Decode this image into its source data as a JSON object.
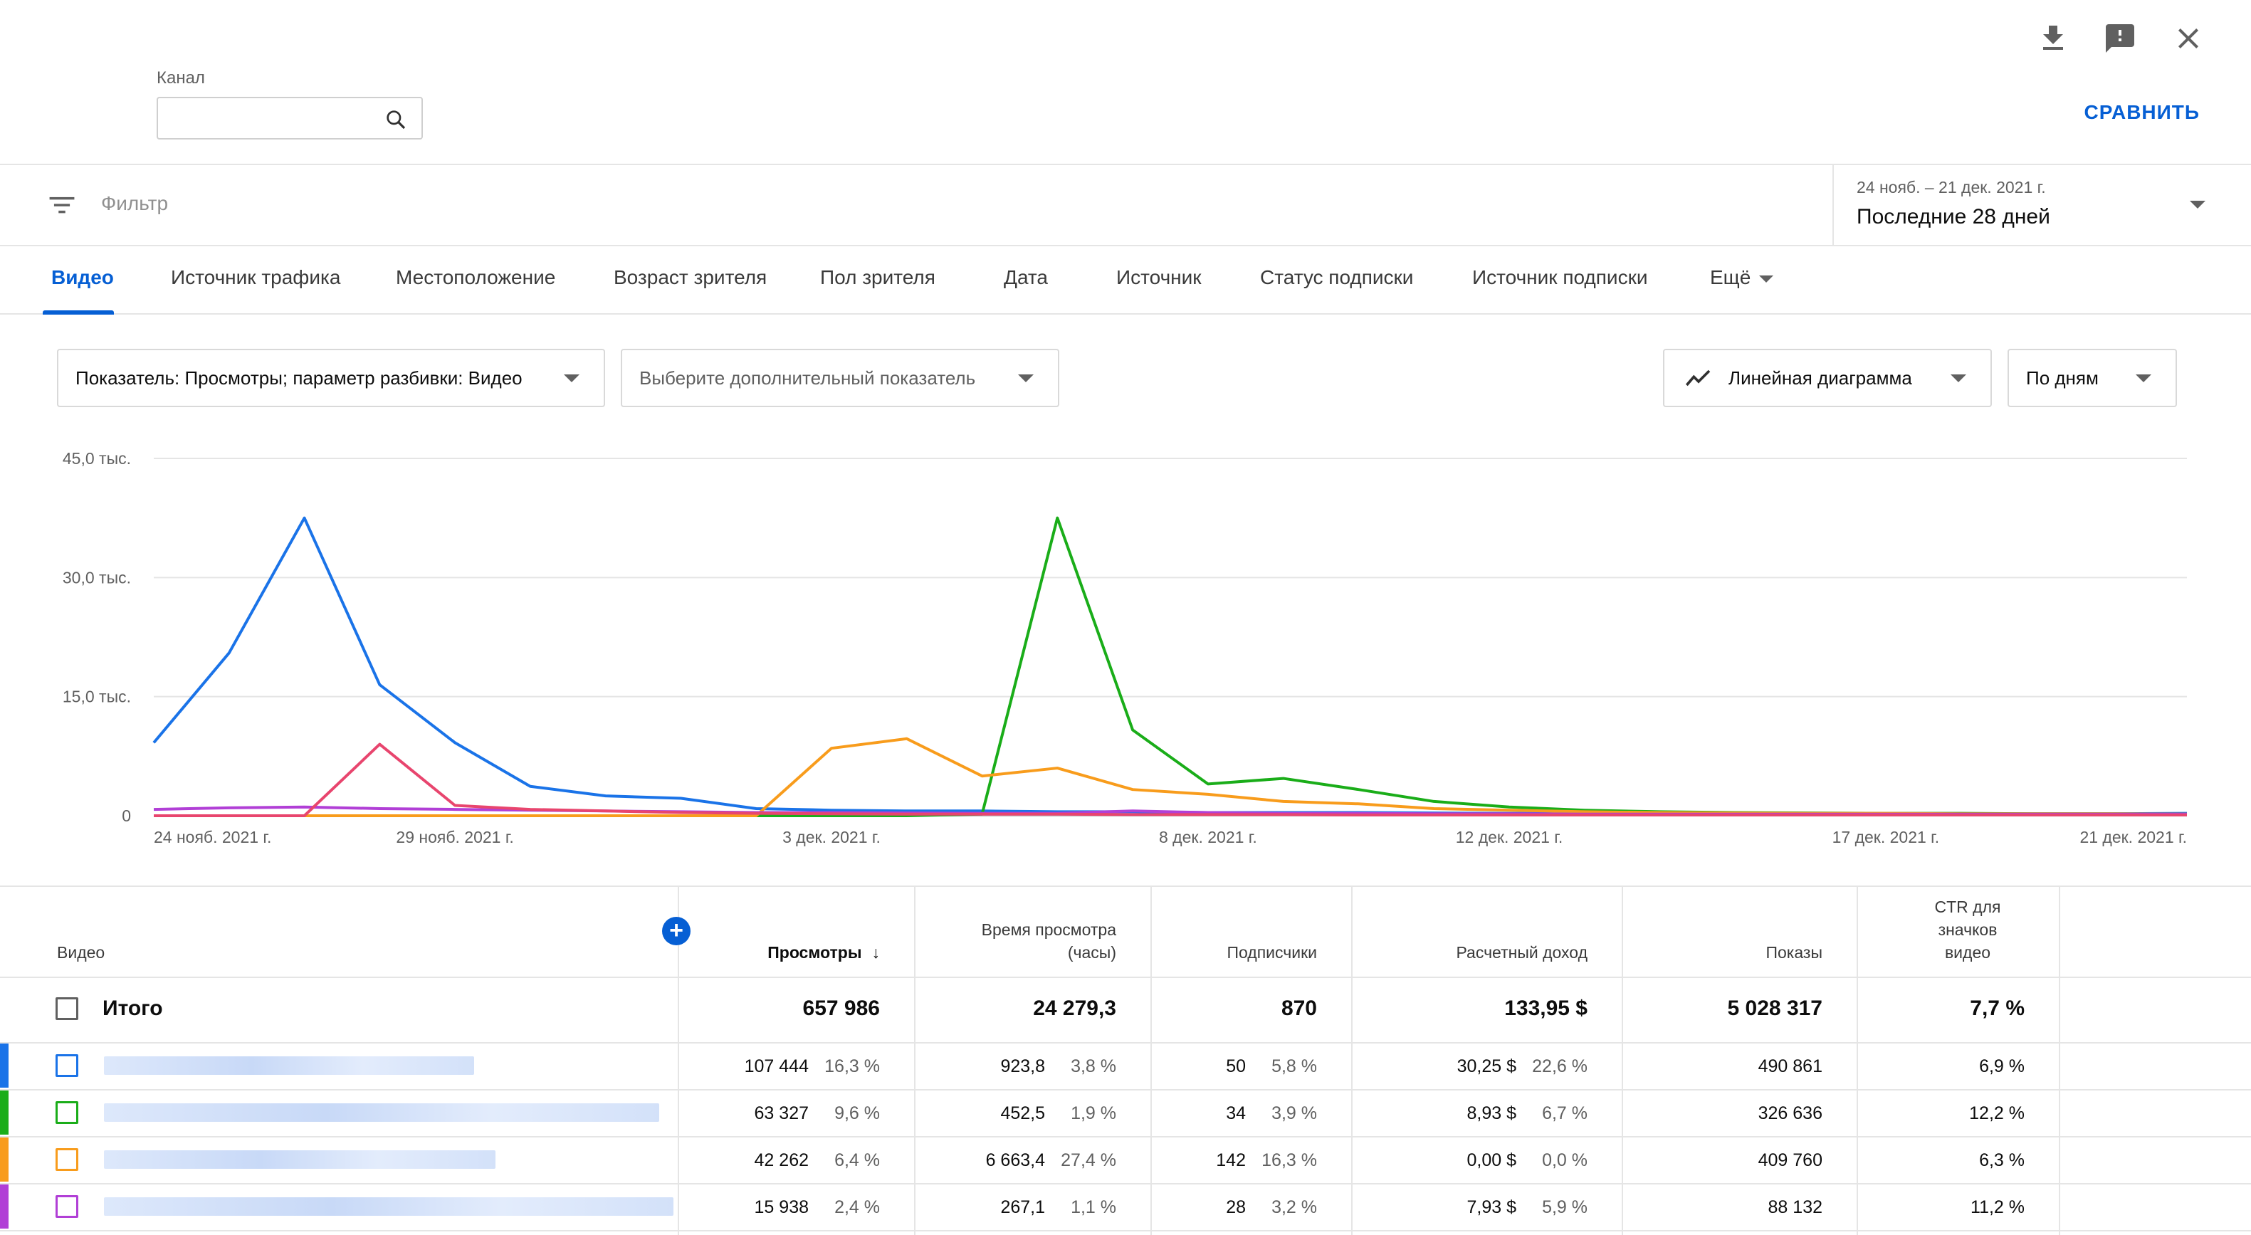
{
  "header": {
    "channel_label": "Канал",
    "channel_value": "",
    "compare_label": "СРАВНИТЬ"
  },
  "icons": {
    "download": "download-icon",
    "feedback": "feedback-icon",
    "close": "close-icon",
    "search": "search-icon",
    "filter": "filter-icon",
    "line_chart": "line-chart-icon"
  },
  "filter": {
    "placeholder": "Фильтр",
    "date_range": "24 нояб. – 21 дек. 2021 г.",
    "period": "Последние 28 дней"
  },
  "tabs": [
    {
      "label": "Видео",
      "active": true
    },
    {
      "label": "Источник трафика"
    },
    {
      "label": "Местоположение"
    },
    {
      "label": "Возраст зрителя"
    },
    {
      "label": "Пол зрителя"
    },
    {
      "label": "Дата"
    },
    {
      "label": "Источник"
    },
    {
      "label": "Статус подписки"
    },
    {
      "label": "Источник подписки"
    },
    {
      "label": "Ещё"
    }
  ],
  "controls": {
    "metric": "Показатель: Просмотры; параметр разбивки: Видео",
    "secondary_metric": "Выберите дополнительный показатель",
    "chart_type": "Линейная диаграмма",
    "granularity": "По дням"
  },
  "colors": {
    "accent": "#065fd4",
    "series1": "#1a73e8",
    "series2": "#1aad19",
    "series3": "#f89c1c",
    "series4": "#b13fd6",
    "series5": "#e8456e"
  },
  "chart_data": {
    "type": "line",
    "ylim": [
      0,
      45000
    ],
    "y_ticks": [
      0,
      15000,
      30000,
      45000
    ],
    "y_tick_labels": [
      "0",
      "15,0 тыс.",
      "30,0 тыс.",
      "45,0 тыс."
    ],
    "x_tick_labels": [
      "24 нояб. 2021 г.",
      "29 нояб. 2021 г.",
      "3 дек. 2021 г.",
      "8 дек. 2021 г.",
      "12 дек. 2021 г.",
      "17 дек. 2021 г.",
      "21 дек. 2021 г."
    ],
    "x_tick_index": [
      0,
      4,
      9,
      14,
      18,
      23,
      27
    ],
    "x_count": 28,
    "series": [
      {
        "color": "#1a73e8",
        "values": [
          9200,
          20500,
          37500,
          16500,
          9200,
          3700,
          2500,
          2200,
          900,
          700,
          600,
          600,
          500,
          500,
          400,
          400,
          400,
          350,
          300,
          300,
          300,
          250,
          250,
          250,
          250,
          250,
          250,
          300
        ]
      },
      {
        "color": "#1aad19",
        "values": [
          0,
          0,
          0,
          0,
          0,
          0,
          0,
          0,
          0,
          0,
          0,
          200,
          37500,
          10800,
          4000,
          4700,
          3300,
          1800,
          1100,
          700,
          500,
          400,
          350,
          300,
          300,
          250,
          250,
          200
        ]
      },
      {
        "color": "#f89c1c",
        "values": [
          0,
          0,
          0,
          0,
          0,
          0,
          0,
          0,
          0,
          8500,
          9700,
          5000,
          6000,
          3300,
          2700,
          1800,
          1500,
          900,
          700,
          500,
          400,
          350,
          300,
          300,
          250,
          250,
          250,
          200
        ]
      },
      {
        "color": "#b13fd6",
        "values": [
          800,
          1000,
          1100,
          900,
          800,
          700,
          600,
          500,
          400,
          400,
          350,
          300,
          300,
          600,
          400,
          300,
          300,
          250,
          250,
          200,
          200,
          200,
          200,
          200,
          200,
          200,
          200,
          200
        ]
      },
      {
        "color": "#e8456e",
        "values": [
          0,
          0,
          0,
          9000,
          1300,
          800,
          600,
          400,
          300,
          250,
          200,
          200,
          200,
          150,
          150,
          150,
          100,
          100,
          100,
          100,
          100,
          100,
          100,
          100,
          100,
          100,
          100,
          100
        ]
      }
    ]
  },
  "table": {
    "headers": {
      "video": "Видео",
      "views": "Просмотры",
      "watch_time_l1": "Время просмотра",
      "watch_time_l2": "(часы)",
      "subscribers": "Подписчики",
      "revenue": "Расчетный доход",
      "impressions": "Показы",
      "ctr_l1": "CTR для",
      "ctr_l2": "значков",
      "ctr_l3": "видео"
    },
    "total": {
      "label": "Итого",
      "views": "657 986",
      "watch_time": "24 279,3",
      "subscribers": "870",
      "revenue": "133,95 $",
      "impressions": "5 028 317",
      "ctr": "7,7 %"
    },
    "rows": [
      {
        "color": "#1a73e8",
        "views": "107 444",
        "views_pct": "16,3 %",
        "watch_time": "923,8",
        "watch_pct": "3,8 %",
        "subscribers": "50",
        "subs_pct": "5,8 %",
        "revenue": "30,25 $",
        "revenue_pct": "22,6 %",
        "impressions": "490 861",
        "ctr": "6,9 %"
      },
      {
        "color": "#1aad19",
        "views": "63 327",
        "views_pct": "9,6 %",
        "watch_time": "452,5",
        "watch_pct": "1,9 %",
        "subscribers": "34",
        "subs_pct": "3,9 %",
        "revenue": "8,93 $",
        "revenue_pct": "6,7 %",
        "impressions": "326 636",
        "ctr": "12,2 %"
      },
      {
        "color": "#f89c1c",
        "views": "42 262",
        "views_pct": "6,4 %",
        "watch_time": "6 663,4",
        "watch_pct": "27,4 %",
        "subscribers": "142",
        "subs_pct": "16,3 %",
        "revenue": "0,00 $",
        "revenue_pct": "0,0 %",
        "impressions": "409 760",
        "ctr": "6,3 %"
      },
      {
        "color": "#b13fd6",
        "views": "15 938",
        "views_pct": "2,4 %",
        "watch_time": "267,1",
        "watch_pct": "1,1 %",
        "subscribers": "28",
        "subs_pct": "3,2 %",
        "revenue": "7,93 $",
        "revenue_pct": "5,9 %",
        "impressions": "88 132",
        "ctr": "11,2 %"
      }
    ]
  }
}
